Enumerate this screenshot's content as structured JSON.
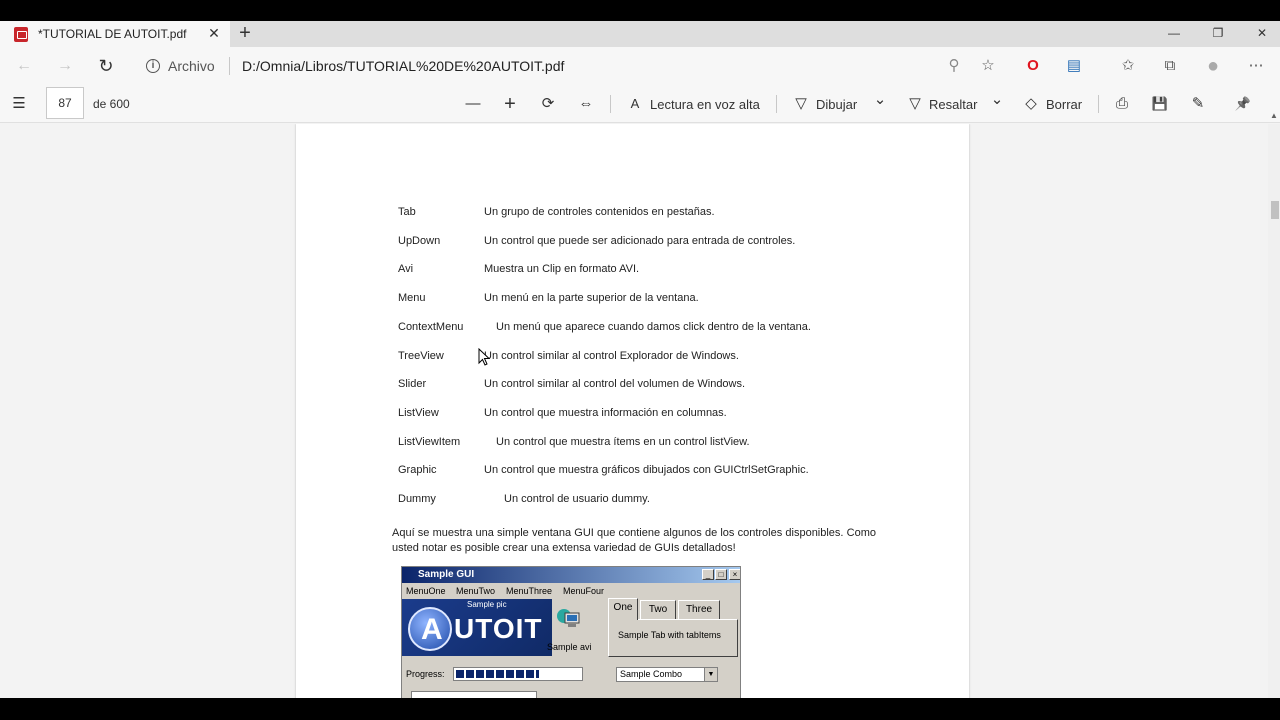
{
  "tab": {
    "title": "*TUTORIAL DE AUTOIT.pdf",
    "close": "✕",
    "new_tab": "+"
  },
  "window_controls": {
    "minimize": "—",
    "restore": "❐",
    "close": "✕"
  },
  "address": {
    "back": "←",
    "forward": "→",
    "refresh": "↻",
    "info": "i",
    "site_label": "Archivo",
    "url": "D:/Omnia/Libros/TUTORIAL%20DE%20AUTOIT.pdf",
    "icons": {
      "zoom": "⚲",
      "favorite": "☆",
      "opera": "O",
      "extension": "▤",
      "favorites": "✩",
      "collections": "⧉",
      "profile": "●",
      "more": "⋯"
    }
  },
  "pdf_toolbar": {
    "contents_icon": "☰",
    "page_number": "87",
    "page_total": "de 600",
    "zoom_out": "—",
    "zoom_in": "+",
    "rotate": "⟳",
    "fit": "⇔",
    "read_aloud_icon": "A",
    "read_aloud": "Lectura en voz alta",
    "draw_icon": "▽",
    "draw": "Dibujar",
    "draw_chevron": "⌄",
    "highlight_icon": "▽",
    "highlight": "Resaltar",
    "highlight_chevron": "⌄",
    "erase_icon": "◇",
    "erase": "Borrar",
    "print": "⎙",
    "save": "💾",
    "save_as": "✎",
    "pin": "📌"
  },
  "document": {
    "controls": [
      {
        "term": "Tab",
        "desc": "Un grupo de controles contenidos en pestañas."
      },
      {
        "term": "UpDown",
        "desc": "Un control que puede ser adicionado para entrada de controles."
      },
      {
        "term": "Avi",
        "desc": "Muestra un Clip en formato AVI."
      },
      {
        "term": "Menu",
        "desc": "Un menú en la parte superior de la ventana."
      },
      {
        "term": "ContextMenu",
        "desc": "Un menú que aparece cuando damos click dentro de la ventana."
      },
      {
        "term": "TreeView",
        "desc": "Un control similar al control  Explorador de Windows."
      },
      {
        "term": "Slider",
        "desc": "Un control similar al control del volumen de Windows."
      },
      {
        "term": "ListView",
        "desc": "Un control que muestra información en columnas."
      },
      {
        "term": "ListViewItem",
        "desc": "Un control que muestra ítems en un control listView."
      },
      {
        "term": "Graphic",
        "desc": "Un control que muestra gráficos dibujados con GUICtrlSetGraphic."
      },
      {
        "term": "Dummy",
        "desc": "Un control de usuario dummy."
      }
    ],
    "paragraph": "Aquí se muestra una simple ventana GUI que contiene algunos de los controles disponibles. Como usted notar es posible crear una extensa variedad de GUIs detallados!",
    "sample_gui": {
      "title": "Sample GUI",
      "menus": [
        "MenuOne",
        "MenuTwo",
        "MenuThree",
        "MenuFour"
      ],
      "logo_text": "UTOIT",
      "pic_label": "Sample pic",
      "avi_label": "Sample avi",
      "tabs": [
        "One",
        "Two",
        "Three"
      ],
      "tab_content": "Sample Tab with tabItems",
      "progress_label": "Progress:",
      "progress": 0.6,
      "combo_value": "Sample Combo",
      "combo_arrow": "▼",
      "btn_min": "_",
      "btn_max": "□",
      "btn_close": "×"
    }
  }
}
